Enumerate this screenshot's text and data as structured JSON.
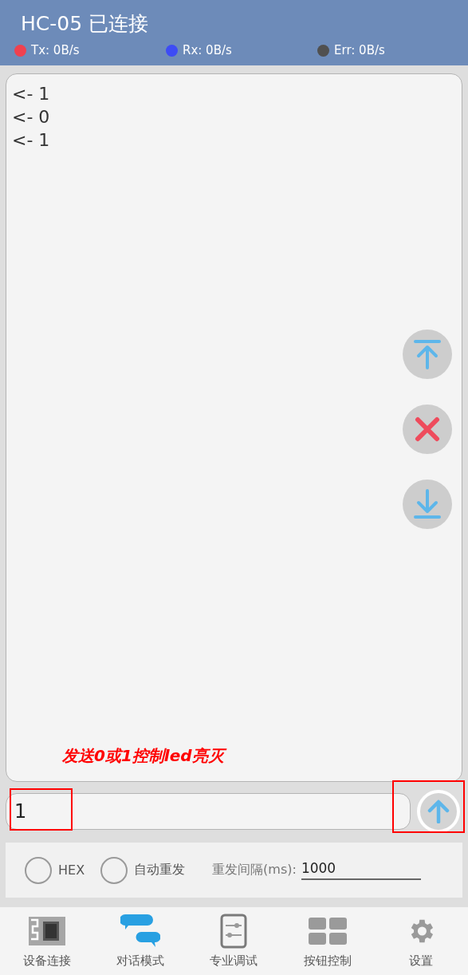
{
  "header": {
    "title": "HC-05 已连接",
    "stats": [
      {
        "label": "Tx: 0B/s",
        "color": "#f0414f"
      },
      {
        "label": "Rx: 0B/s",
        "color": "#3d4cf5"
      },
      {
        "label": "Err: 0B/s",
        "color": "#505050"
      }
    ]
  },
  "log": {
    "lines": [
      "<- 1",
      "<- 0",
      "<- 1"
    ]
  },
  "annotation": {
    "text": "发送0或1控制led亮灭"
  },
  "input": {
    "value": "1"
  },
  "options": {
    "hex": {
      "label": "HEX",
      "checked": false
    },
    "auto_resend": {
      "label": "自动重发",
      "checked": false
    },
    "interval": {
      "label": "重发间隔(ms):",
      "value": "1000"
    }
  },
  "tabs": [
    {
      "label": "设备连接",
      "kind": "device",
      "selected": false
    },
    {
      "label": "对话模式",
      "kind": "chat",
      "selected": true
    },
    {
      "label": "专业调试",
      "kind": "sliders",
      "selected": false
    },
    {
      "label": "按钮控制",
      "kind": "grid",
      "selected": false
    },
    {
      "label": "设置",
      "kind": "gear",
      "selected": false
    }
  ]
}
